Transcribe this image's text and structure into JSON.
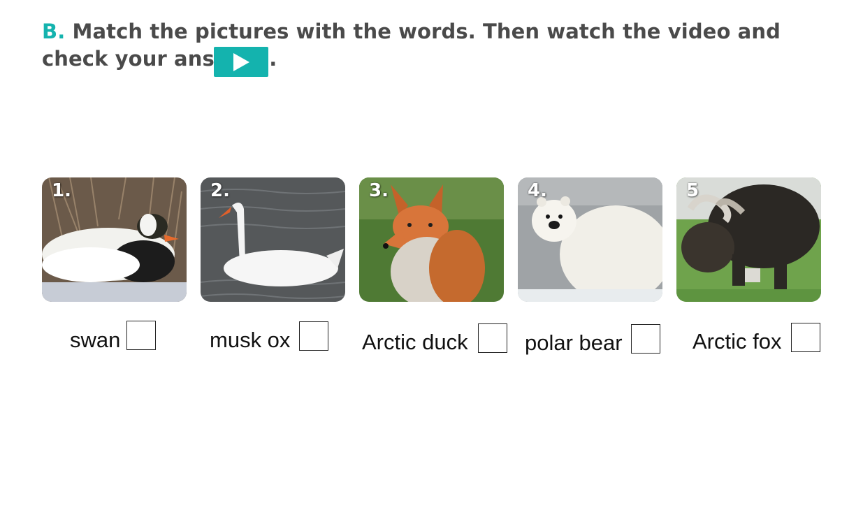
{
  "exercise": {
    "letter": "B.",
    "instruction": "Match the pictures with the words. Then watch the video and check your answers.",
    "accent_color": "#14b3ae",
    "play_icon": "play-icon"
  },
  "pictures": [
    {
      "number": "1.",
      "subject": "eider duck"
    },
    {
      "number": "2.",
      "subject": "swan"
    },
    {
      "number": "3.",
      "subject": "fox"
    },
    {
      "number": "4.",
      "subject": "polar bear"
    },
    {
      "number": "5",
      "subject": "musk ox"
    }
  ],
  "words": [
    {
      "label": "swan",
      "answer": ""
    },
    {
      "label": "musk ox",
      "answer": ""
    },
    {
      "label": "Arctic duck",
      "answer": ""
    },
    {
      "label": "polar bear",
      "answer": ""
    },
    {
      "label": "Arctic fox",
      "answer": ""
    }
  ]
}
